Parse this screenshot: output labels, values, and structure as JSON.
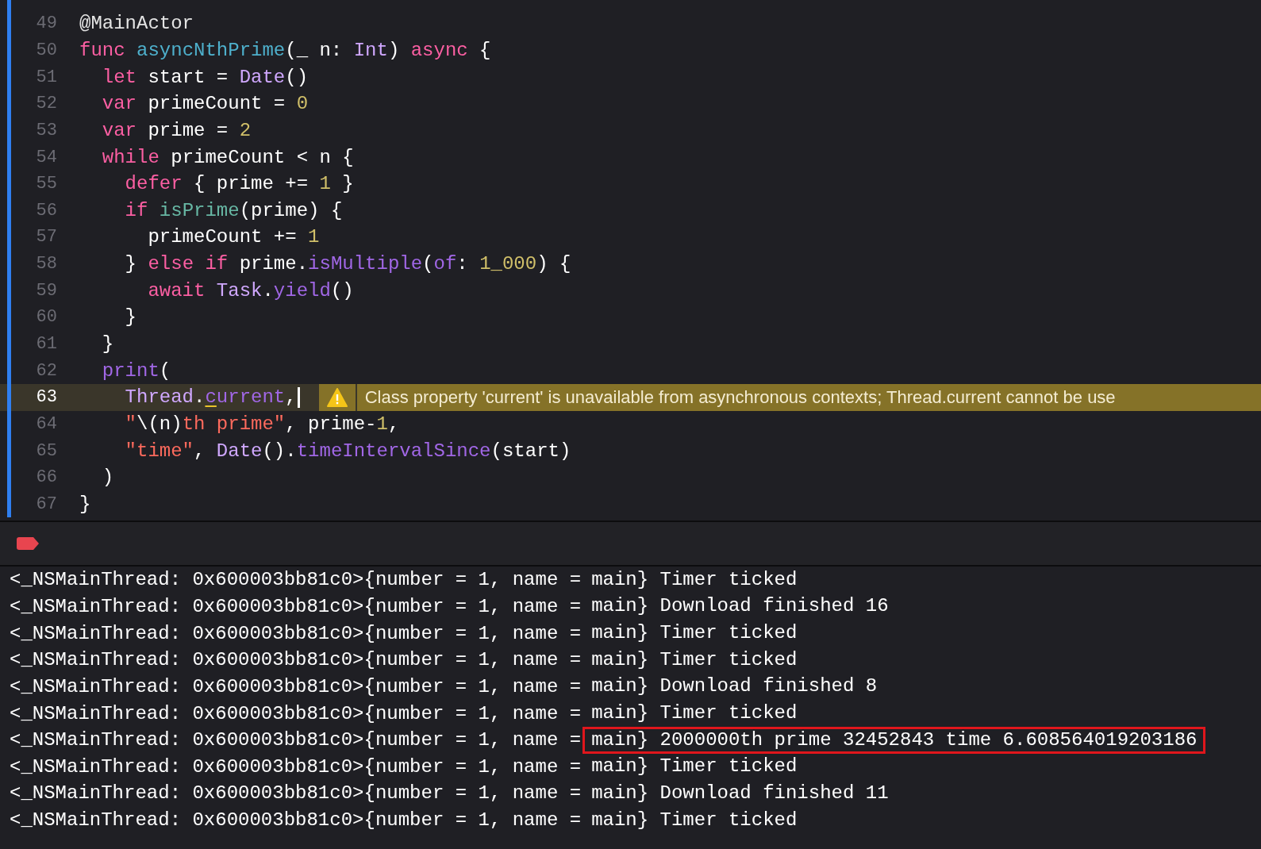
{
  "editor": {
    "lines": [
      {
        "number": "49",
        "current": false,
        "tokens": [
          {
            "t": "@MainActor",
            "kind": "attr"
          }
        ]
      },
      {
        "number": "50",
        "current": false,
        "tokens": [
          {
            "t": "func ",
            "kind": "kw"
          },
          {
            "t": "asyncNthPrime",
            "kind": "fn"
          },
          {
            "t": "(_ n: ",
            "kind": "plain"
          },
          {
            "t": "Int",
            "kind": "type"
          },
          {
            "t": ") ",
            "kind": "plain"
          },
          {
            "t": "async",
            "kind": "kw"
          },
          {
            "t": " {",
            "kind": "plain"
          }
        ]
      },
      {
        "number": "51",
        "current": false,
        "tokens": [
          {
            "t": "  let",
            "kind": "kw"
          },
          {
            "t": " start = ",
            "kind": "plain"
          },
          {
            "t": "Date",
            "kind": "type"
          },
          {
            "t": "()",
            "kind": "plain"
          }
        ]
      },
      {
        "number": "52",
        "current": false,
        "tokens": [
          {
            "t": "  var",
            "kind": "kw"
          },
          {
            "t": " primeCount = ",
            "kind": "plain"
          },
          {
            "t": "0",
            "kind": "num"
          }
        ]
      },
      {
        "number": "53",
        "current": false,
        "tokens": [
          {
            "t": "  var",
            "kind": "kw"
          },
          {
            "t": " prime = ",
            "kind": "plain"
          },
          {
            "t": "2",
            "kind": "num"
          }
        ]
      },
      {
        "number": "54",
        "current": false,
        "tokens": [
          {
            "t": "  while",
            "kind": "kw"
          },
          {
            "t": " primeCount < n {",
            "kind": "plain"
          }
        ]
      },
      {
        "number": "55",
        "current": false,
        "tokens": [
          {
            "t": "    defer",
            "kind": "kw"
          },
          {
            "t": " { prime += ",
            "kind": "plain"
          },
          {
            "t": "1",
            "kind": "num"
          },
          {
            "t": " }",
            "kind": "plain"
          }
        ]
      },
      {
        "number": "56",
        "current": false,
        "tokens": [
          {
            "t": "    if ",
            "kind": "kw"
          },
          {
            "t": "isPrime",
            "kind": "call"
          },
          {
            "t": "(prime) {",
            "kind": "plain"
          }
        ]
      },
      {
        "number": "57",
        "current": false,
        "tokens": [
          {
            "t": "      primeCount += ",
            "kind": "plain"
          },
          {
            "t": "1",
            "kind": "num"
          }
        ]
      },
      {
        "number": "58",
        "current": false,
        "tokens": [
          {
            "t": "    } ",
            "kind": "plain"
          },
          {
            "t": "else if",
            "kind": "kw"
          },
          {
            "t": " prime.",
            "kind": "plain"
          },
          {
            "t": "isMultiple",
            "kind": "method"
          },
          {
            "t": "(",
            "kind": "plain"
          },
          {
            "t": "of",
            "kind": "method"
          },
          {
            "t": ": ",
            "kind": "plain"
          },
          {
            "t": "1_000",
            "kind": "num"
          },
          {
            "t": ") {",
            "kind": "plain"
          }
        ]
      },
      {
        "number": "59",
        "current": false,
        "tokens": [
          {
            "t": "      await ",
            "kind": "kw"
          },
          {
            "t": "Task",
            "kind": "type"
          },
          {
            "t": ".",
            "kind": "plain"
          },
          {
            "t": "yield",
            "kind": "method"
          },
          {
            "t": "()",
            "kind": "plain"
          }
        ]
      },
      {
        "number": "60",
        "current": false,
        "tokens": [
          {
            "t": "    }",
            "kind": "plain"
          }
        ]
      },
      {
        "number": "61",
        "current": false,
        "tokens": [
          {
            "t": "  }",
            "kind": "plain"
          }
        ]
      },
      {
        "number": "62",
        "current": false,
        "tokens": [
          {
            "t": "  print",
            "kind": "method"
          },
          {
            "t": "(",
            "kind": "plain"
          }
        ]
      },
      {
        "number": "63",
        "current": true,
        "cursor": true,
        "warning": "Class property 'current' is unavailable from asynchronous contexts; Thread.current cannot be use",
        "tokens": [
          {
            "t": "    Thread",
            "kind": "type"
          },
          {
            "t": ".",
            "kind": "plain"
          },
          {
            "t": "c",
            "kind": "method",
            "underlined": true
          },
          {
            "t": "urrent",
            "kind": "method"
          },
          {
            "t": ",",
            "kind": "plain"
          }
        ]
      },
      {
        "number": "64",
        "current": false,
        "tokens": [
          {
            "t": "    \"",
            "kind": "str"
          },
          {
            "t": "\\(n)",
            "kind": "plain"
          },
          {
            "t": "th prime\"",
            "kind": "str"
          },
          {
            "t": ", prime-",
            "kind": "plain"
          },
          {
            "t": "1",
            "kind": "num"
          },
          {
            "t": ",",
            "kind": "plain"
          }
        ]
      },
      {
        "number": "65",
        "current": false,
        "tokens": [
          {
            "t": "    \"time\"",
            "kind": "str"
          },
          {
            "t": ", ",
            "kind": "plain"
          },
          {
            "t": "Date",
            "kind": "type"
          },
          {
            "t": "().",
            "kind": "plain"
          },
          {
            "t": "timeIntervalSince",
            "kind": "method"
          },
          {
            "t": "(start)",
            "kind": "plain"
          }
        ]
      },
      {
        "number": "66",
        "current": false,
        "tokens": [
          {
            "t": "  )",
            "kind": "plain"
          }
        ]
      },
      {
        "number": "67",
        "current": false,
        "tokens": [
          {
            "t": "}",
            "kind": "plain"
          }
        ]
      }
    ]
  },
  "console": {
    "lines": [
      {
        "prefix": "<_NSMainThread: 0x600003bb81c0>{number = 1, name =",
        "message": "main} Timer ticked",
        "highlighted": false
      },
      {
        "prefix": "<_NSMainThread: 0x600003bb81c0>{number = 1, name =",
        "message": "main} Download finished 16",
        "highlighted": false
      },
      {
        "prefix": "<_NSMainThread: 0x600003bb81c0>{number = 1, name =",
        "message": "main} Timer ticked",
        "highlighted": false
      },
      {
        "prefix": "<_NSMainThread: 0x600003bb81c0>{number = 1, name =",
        "message": "main} Timer ticked",
        "highlighted": false
      },
      {
        "prefix": "<_NSMainThread: 0x600003bb81c0>{number = 1, name =",
        "message": "main} Download finished 8",
        "highlighted": false
      },
      {
        "prefix": "<_NSMainThread: 0x600003bb81c0>{number = 1, name =",
        "message": "main} Timer ticked",
        "highlighted": false
      },
      {
        "prefix": "<_NSMainThread: 0x600003bb81c0>{number = 1, name =",
        "message": "main} 2000000th prime 32452843 time 6.608564019203186",
        "highlighted": true
      },
      {
        "prefix": "<_NSMainThread: 0x600003bb81c0>{number = 1, name =",
        "message": "main} Timer ticked",
        "highlighted": false
      },
      {
        "prefix": "<_NSMainThread: 0x600003bb81c0>{number = 1, name =",
        "message": "main} Download finished 11",
        "highlighted": false
      },
      {
        "prefix": "<_NSMainThread: 0x600003bb81c0>{number = 1, name =",
        "message": "main} Timer ticked",
        "highlighted": false
      }
    ]
  }
}
